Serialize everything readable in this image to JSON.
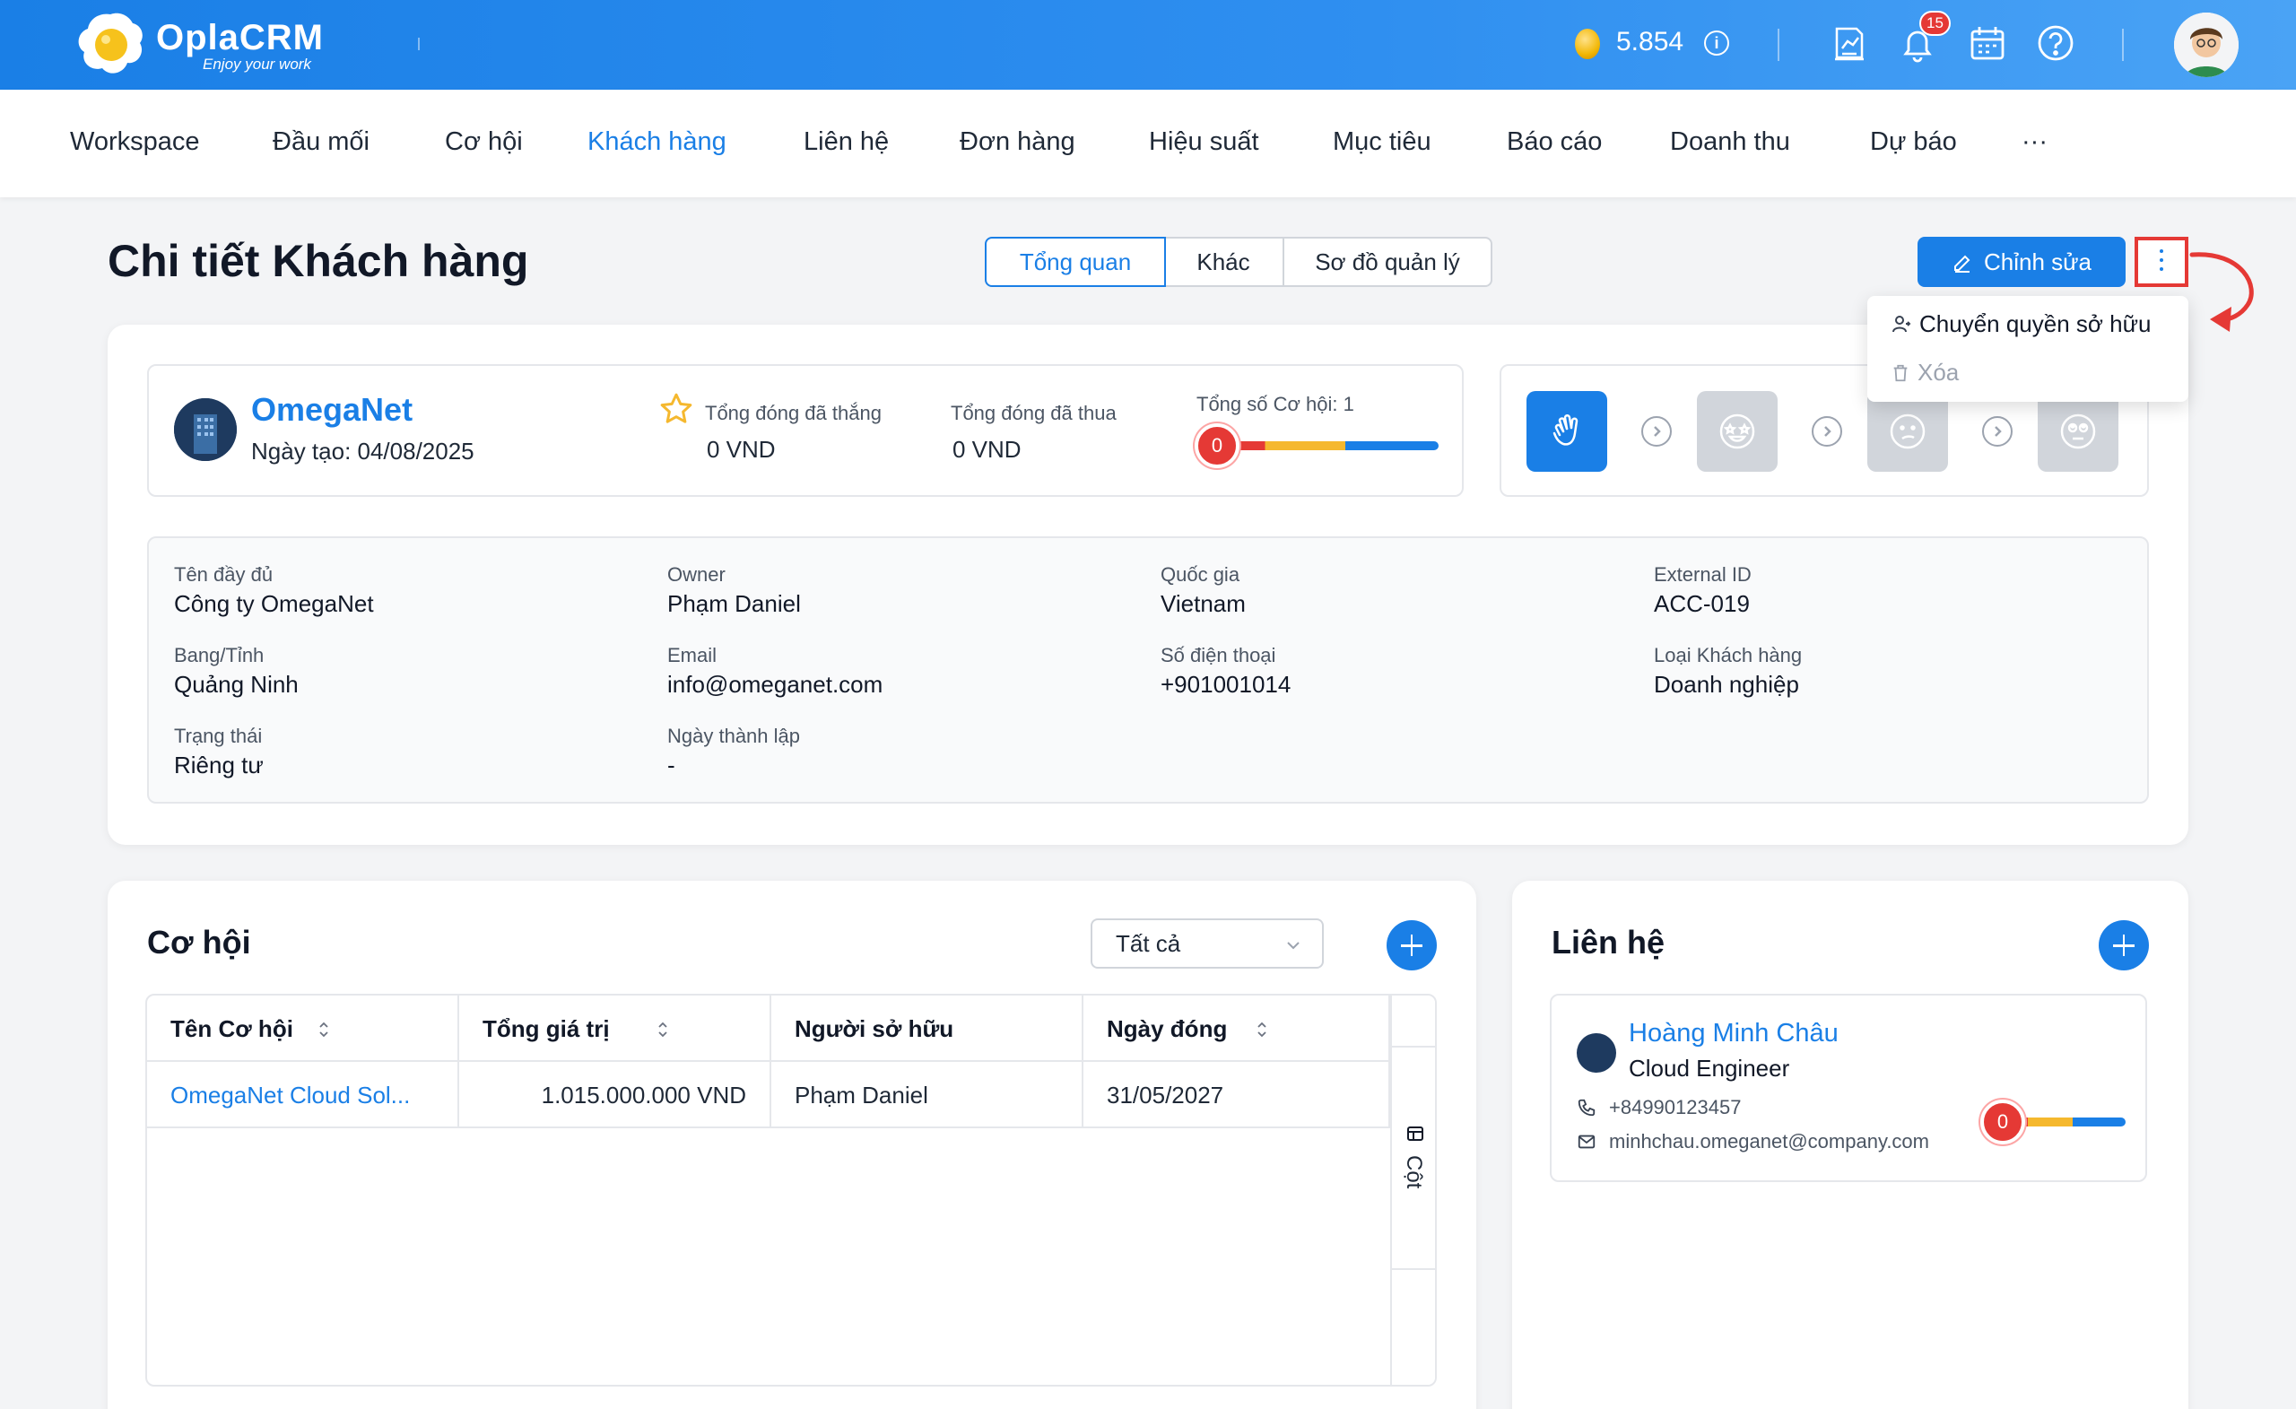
{
  "app": {
    "brand": "OplaCRM",
    "tagline": "Enjoy your work",
    "coins": "5.854",
    "notifications_count": "15",
    "accent": "#1a7fe6"
  },
  "nav": {
    "items": [
      "Workspace",
      "Đầu mối",
      "Cơ hội",
      "Khách hàng",
      "Liên hệ",
      "Đơn hàng",
      "Hiệu suất",
      "Mục tiêu",
      "Báo cáo",
      "Doanh thu",
      "Dự báo",
      "···"
    ],
    "active": "Khách hàng"
  },
  "header": {
    "title": "Chi tiết Khách hàng",
    "tabs": [
      "Tổng quan",
      "Khác",
      "Sơ đồ quản lý"
    ],
    "active_tab": "Tổng quan",
    "edit_label": "Chỉnh sửa"
  },
  "menu": {
    "transfer_owner": "Chuyển quyền sở hữu",
    "delete": "Xóa"
  },
  "account": {
    "name": "OmegaNet",
    "created": "Ngày tạo: 04/08/2025",
    "won_label": "Tổng đóng đã thắng",
    "won_value": "0 VND",
    "lost_label": "Tổng đóng đã thua",
    "lost_value": "0 VND",
    "opps_label": "Tổng số Cơ hội: ",
    "opps_count": "1",
    "score": "0"
  },
  "fields": {
    "full_name_label": "Tên đầy đủ",
    "full_name": "Công ty OmegaNet",
    "owner_label": "Owner",
    "owner": "Phạm Daniel",
    "country_label": "Quốc gia",
    "country": "Vietnam",
    "external_id_label": "External ID",
    "external_id": "ACC-019",
    "state_label": "Bang/Tỉnh",
    "state": "Quảng Ninh",
    "email_label": "Email",
    "email": "info@omeganet.com",
    "phone_label": "Số điện thoại",
    "phone": "+901001014",
    "type_label": "Loại Khách hàng",
    "type": "Doanh nghiệp",
    "status_label": "Trạng thái",
    "status": "Riêng tư",
    "founded_label": "Ngày thành lập",
    "founded": "-"
  },
  "opportunities": {
    "title": "Cơ hội",
    "filter": "Tất cả",
    "columns": [
      "Tên Cơ hội",
      "Tổng giá trị",
      "Người sở hữu",
      "Ngày đóng"
    ],
    "rows": [
      {
        "name": "OmegaNet Cloud Sol...",
        "value": "1.015.000.000 VND",
        "owner": "Phạm Daniel",
        "close_date": "31/05/2027"
      }
    ],
    "columns_toggle": "Cột"
  },
  "contacts": {
    "title": "Liên hệ",
    "items": [
      {
        "name": "Hoàng Minh Châu",
        "role": "Cloud Engineer",
        "phone": "+84990123457",
        "email": "minhchau.omeganet@company.com",
        "score": "0"
      }
    ]
  }
}
